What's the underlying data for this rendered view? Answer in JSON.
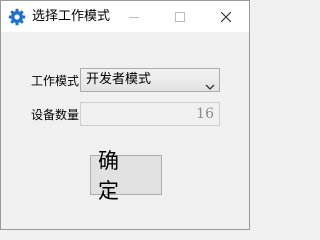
{
  "window": {
    "title": "选择工作模式",
    "icon": "gear-icon",
    "controls": [
      "minimize-icon",
      "maximize-icon",
      "close-icon"
    ]
  },
  "form": {
    "mode_label": "工作模式:",
    "mode_value": "开发者模式",
    "count_label": "设备数量:",
    "count_value": "16"
  },
  "actions": {
    "ok_label": "确 定"
  },
  "colors": {
    "icon_blue": "#1e6fd0",
    "window_bg": "#f0f0f0",
    "titlebar_bg": "#ffffff",
    "disabled_text": "#8a8a8a"
  }
}
